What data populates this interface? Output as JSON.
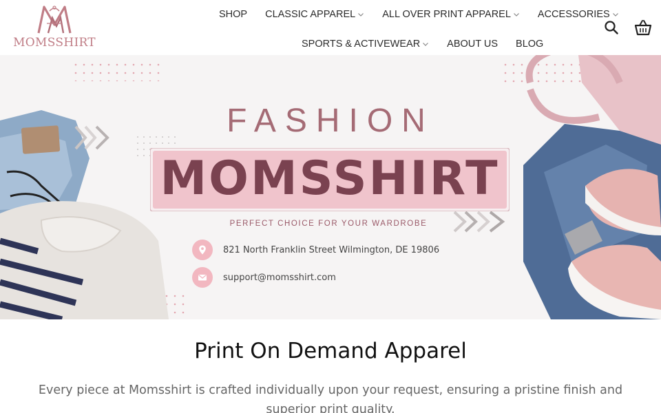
{
  "brand": {
    "logo_text": "MOMSSHIRT",
    "primary_color": "#c07d86",
    "accent_color": "#7a4250"
  },
  "nav": {
    "row1": [
      {
        "label": "SHOP",
        "has_dropdown": false
      },
      {
        "label": "CLASSIC APPAREL",
        "has_dropdown": true
      },
      {
        "label": "ALL OVER PRINT APPAREL",
        "has_dropdown": true
      },
      {
        "label": "ACCESSORIES",
        "has_dropdown": true
      }
    ],
    "row2": [
      {
        "label": "SPORTS & ACTIVEWEAR",
        "has_dropdown": true
      },
      {
        "label": "ABOUT US",
        "has_dropdown": false
      },
      {
        "label": "BLOG",
        "has_dropdown": false
      }
    ],
    "icons": [
      "search-icon",
      "cart-icon"
    ]
  },
  "hero": {
    "title": "FASHION",
    "brand": "MOMSSHIRT",
    "tagline": "PERFECT CHOICE FOR YOUR WARDROBE",
    "address": "821 North Franklin Street Wilmington, DE 19806",
    "email": "support@momsshirt.com",
    "icons": [
      "location-pin-icon",
      "envelope-icon"
    ]
  },
  "content": {
    "title": "Print On Demand Apparel",
    "text": "Every piece at Momsshirt is crafted individually upon your request, ensuring a pristine finish and superior print quality."
  }
}
